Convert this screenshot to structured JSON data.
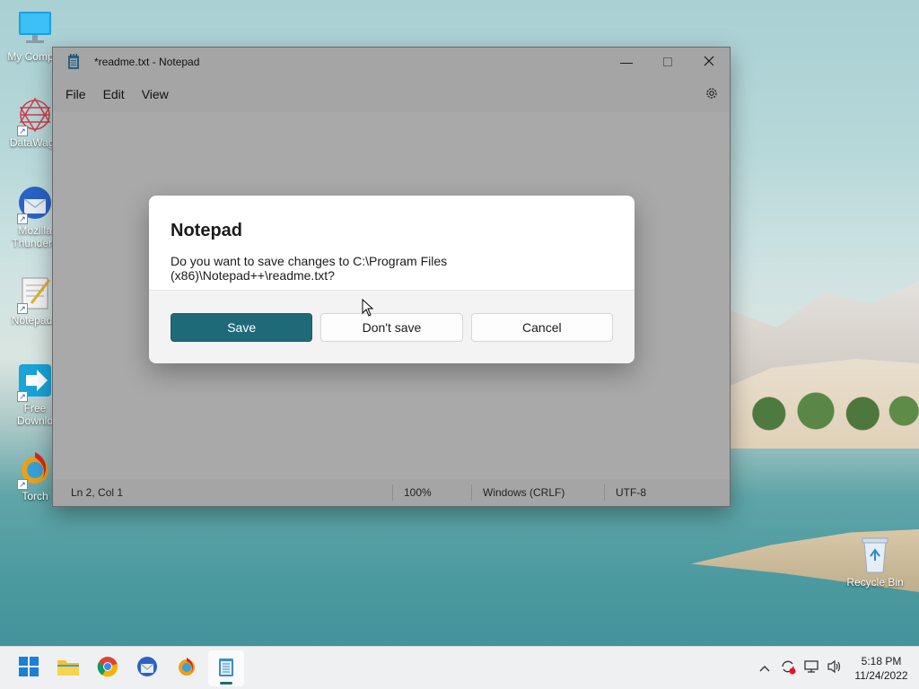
{
  "desktop": {
    "icons": [
      {
        "label": "My Comput"
      },
      {
        "label": "DataWago"
      },
      {
        "label": "Mozilla\nThunderb"
      },
      {
        "label": "Notepad+"
      },
      {
        "label": "Free\nDownlo"
      },
      {
        "label": "Torch"
      }
    ],
    "recycle_bin": "Recycle Bin"
  },
  "window": {
    "title": "*readme.txt - Notepad",
    "menu": [
      "File",
      "Edit",
      "View"
    ],
    "status": {
      "position": "Ln 2, Col 1",
      "zoom": "100%",
      "line_ending": "Windows (CRLF)",
      "encoding": "UTF-8"
    }
  },
  "dialog": {
    "title": "Notepad",
    "message": "Do you want to save changes to C:\\Program Files (x86)\\Notepad++\\readme.txt?",
    "save": "Save",
    "dont_save": "Don't save",
    "cancel": "Cancel"
  },
  "taskbar": {
    "apps": [
      "start-icon",
      "file-explorer-icon",
      "chrome-icon",
      "thunderbird-icon",
      "torch-icon",
      "notepad-icon"
    ],
    "clock": {
      "time": "5:18 PM",
      "date": "11/24/2022"
    }
  },
  "colors": {
    "accent": "#1f6a78"
  }
}
